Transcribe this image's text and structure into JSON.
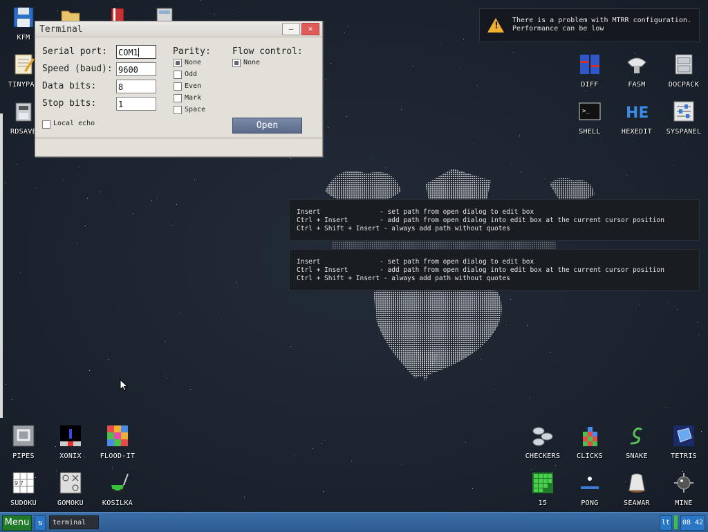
{
  "notification": {
    "line1": "There is a problem with MTRR configuration.",
    "line2": "Performance can be low",
    "icon": "warning-icon",
    "icon_color": "#f0b030"
  },
  "hints": [
    {
      "rows": [
        "Insert               - set path from open dialog to edit box",
        "Ctrl + Insert        - add path from open dialog into edit box at the current cursor position",
        "Ctrl + Shift + Insert - always add path without quotes"
      ]
    },
    {
      "rows": [
        "Insert               - set path from open dialog to edit box",
        "Ctrl + Insert        - add path from open dialog into edit box at the current cursor position",
        "Ctrl + Shift + Insert - always add path without quotes"
      ]
    }
  ],
  "window": {
    "title": "Terminal",
    "minimize_label": "—",
    "close_label": "×",
    "serial_port_label": "Serial port:",
    "serial_port_value": "COM1",
    "speed_label": "Speed (baud):",
    "speed_value": "9600",
    "data_bits_label": "Data bits:",
    "data_bits_value": "8",
    "stop_bits_label": "Stop bits:",
    "stop_bits_value": "1",
    "parity_label": "Parity:",
    "parity_options": [
      "None",
      "Odd",
      "Even",
      "Mark",
      "Space"
    ],
    "parity_selected": "None",
    "flow_label": "Flow control:",
    "flow_options": [
      "None"
    ],
    "flow_selected": "None",
    "local_echo_label": "Local echo",
    "open_label": "Open"
  },
  "desktop_icons_left_top": [
    {
      "label": "KFM"
    },
    {
      "label": "TINYPAD"
    },
    {
      "label": "RDSAVE"
    }
  ],
  "desktop_icons_right_top": [
    {
      "label": "DIFF"
    },
    {
      "label": "FASM"
    },
    {
      "label": "DOCPACK"
    },
    {
      "label": "SHELL"
    },
    {
      "label": "HEXEDIT"
    },
    {
      "label": "SYSPANEL"
    }
  ],
  "desktop_icons_bottom_left": [
    {
      "label": "PIPES"
    },
    {
      "label": "XONIX"
    },
    {
      "label": "FLOOD-IT"
    },
    {
      "label": "SUDOKU"
    },
    {
      "label": "GOMOKU"
    },
    {
      "label": "KOSILKA"
    }
  ],
  "desktop_icons_bottom_right": [
    {
      "label": "CHECKERS"
    },
    {
      "label": "CLICKS"
    },
    {
      "label": "SNAKE"
    },
    {
      "label": "TETRIS"
    },
    {
      "label": "15"
    },
    {
      "label": "PONG"
    },
    {
      "label": "SEAWAR"
    },
    {
      "label": "MINE"
    }
  ],
  "taskbar": {
    "menu_label": "Menu",
    "task_label": "terminal",
    "lang_label": "lt",
    "clock": "08 42"
  },
  "colors": {
    "desktop_bg": "#1c2430",
    "taskbar": "#3a6ea8",
    "menu_button": "#1f7a2a",
    "open_button": "#5a6a8a"
  }
}
